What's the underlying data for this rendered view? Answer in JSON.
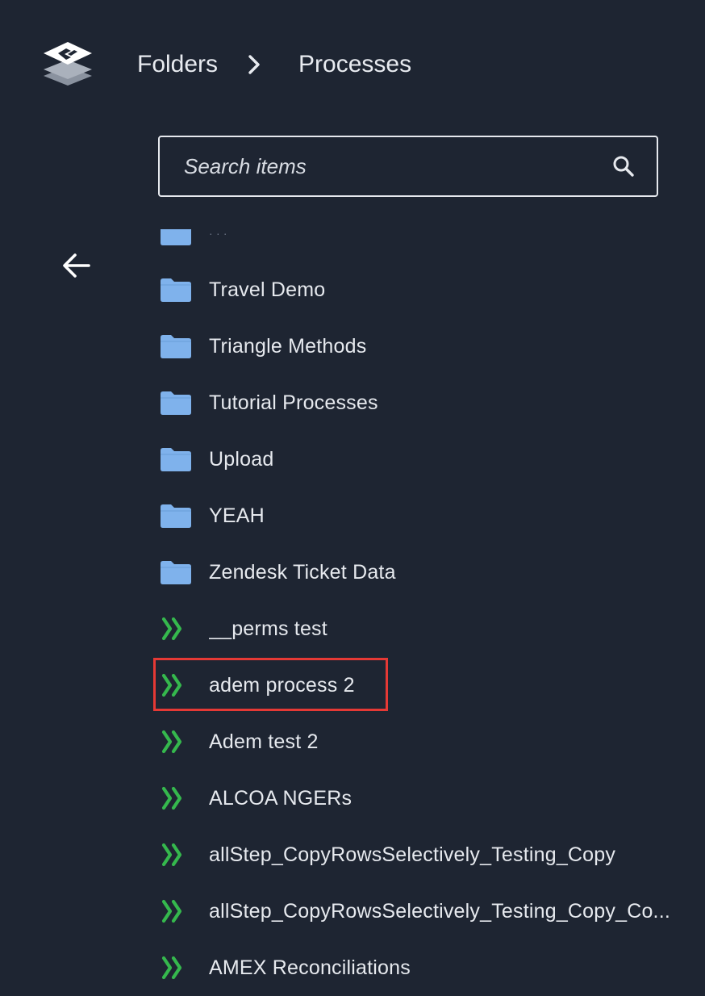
{
  "breadcrumb": {
    "items": [
      "Folders",
      "Processes"
    ]
  },
  "search": {
    "placeholder": "Search items"
  },
  "colors": {
    "background": "#1e2532",
    "folder": "#7fb2ec",
    "process": "#35b84d",
    "highlight": "#e53935"
  },
  "list": {
    "items": [
      {
        "label": "· · ·",
        "type": "folder"
      },
      {
        "label": "Travel Demo",
        "type": "folder"
      },
      {
        "label": "Triangle Methods",
        "type": "folder"
      },
      {
        "label": "Tutorial Processes",
        "type": "folder"
      },
      {
        "label": "Upload",
        "type": "folder"
      },
      {
        "label": "YEAH",
        "type": "folder"
      },
      {
        "label": "Zendesk Ticket Data",
        "type": "folder"
      },
      {
        "label": "__perms test",
        "type": "process"
      },
      {
        "label": "adem process 2",
        "type": "process",
        "highlighted": true
      },
      {
        "label": "Adem test 2",
        "type": "process"
      },
      {
        "label": "ALCOA NGERs",
        "type": "process"
      },
      {
        "label": "allStep_CopyRowsSelectively_Testing_Copy",
        "type": "process"
      },
      {
        "label": "allStep_CopyRowsSelectively_Testing_Copy_Co...",
        "type": "process"
      },
      {
        "label": "AMEX Reconciliations",
        "type": "process"
      }
    ]
  }
}
